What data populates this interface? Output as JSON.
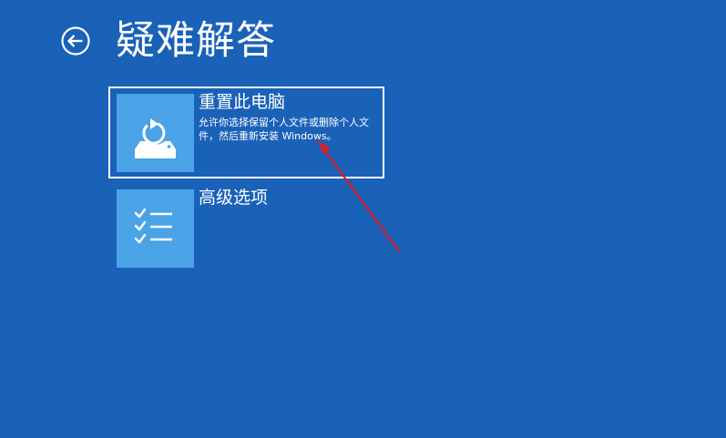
{
  "header": {
    "back_icon": "back-arrow-icon",
    "title": "疑难解答"
  },
  "options": [
    {
      "title": "重置此电脑",
      "description": "允许你选择保留个人文件或删除个人文件，然后重新安装 Windows。",
      "icon": "reset-pc-icon",
      "selected": true
    },
    {
      "title": "高级选项",
      "description": "",
      "icon": "checklist-icon",
      "selected": false
    }
  ],
  "colors": {
    "background": "#1a61b8",
    "tile": "#4aa3e6",
    "text": "#ffffff",
    "annotation_arrow": "#d91e2a"
  }
}
